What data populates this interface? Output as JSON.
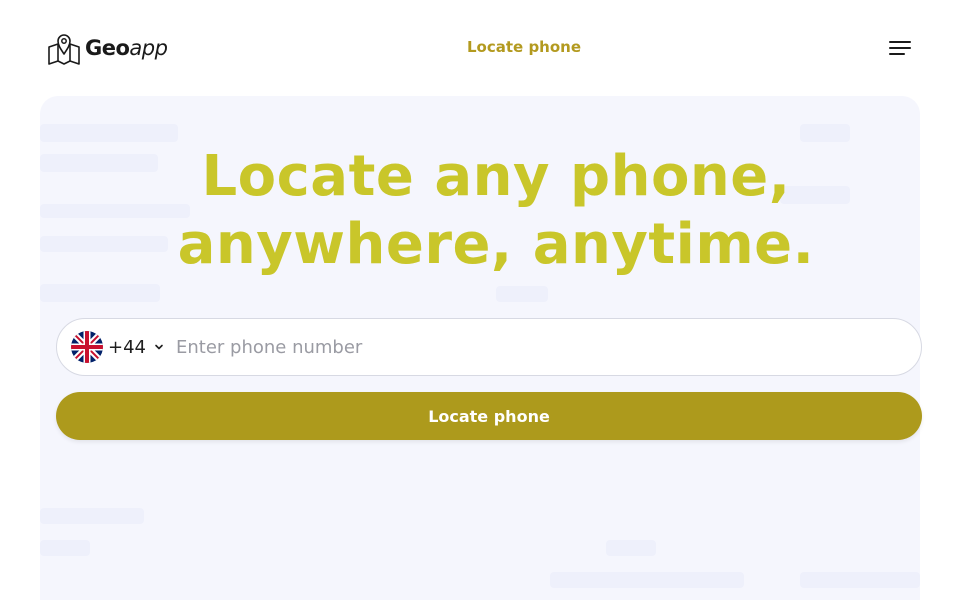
{
  "header": {
    "logo": {
      "brand_bold": "Geo",
      "brand_light": "app",
      "icon": "map-pin-icon"
    },
    "nav_link": "Locate phone",
    "menu_icon": "hamburger-menu-icon"
  },
  "hero": {
    "headline_line1": "Locate any phone,",
    "headline_line2": "anywhere, anytime."
  },
  "form": {
    "country": {
      "flag": "uk-flag-icon",
      "dial_code": "+44"
    },
    "phone_input": {
      "value": "",
      "placeholder": "Enter phone number"
    },
    "submit_label": "Locate phone"
  },
  "colors": {
    "accent_link": "#b39a1f",
    "headline": "#c9c62a",
    "button": "#ad9a1c",
    "hero_background": "#f5f6fd"
  }
}
